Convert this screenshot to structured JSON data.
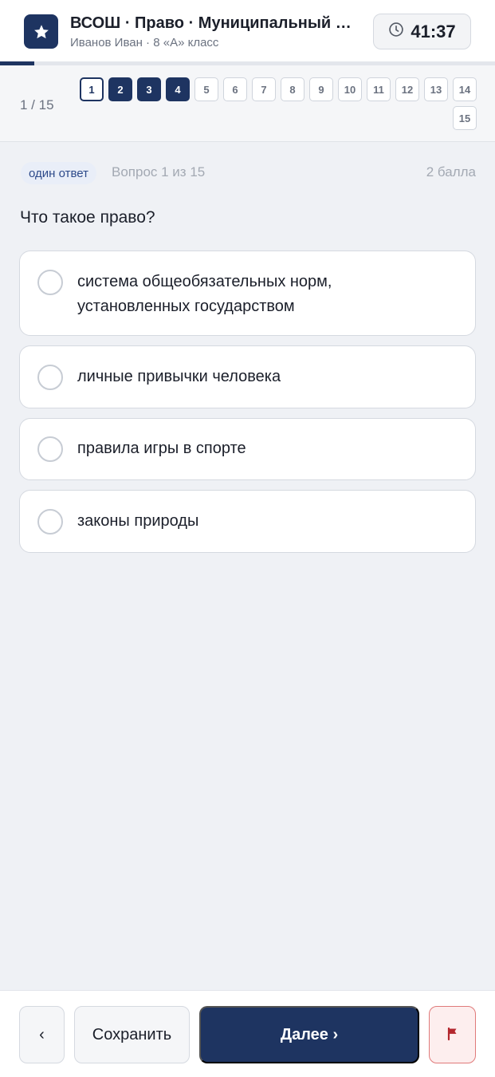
{
  "header": {
    "title": "ВСОШ · Право · Муниципальный этап",
    "subtitle": "Иванов Иван · 8 «А» класс",
    "timer": "41:37",
    "logo_icon": "star-icon",
    "timer_icon": "clock-icon"
  },
  "progress": {
    "fraction": 0.07
  },
  "question_nav": {
    "counter": "1 / 15",
    "buttons": [
      {
        "label": "1",
        "state": "current"
      },
      {
        "label": "2",
        "state": "answered"
      },
      {
        "label": "3",
        "state": "answered"
      },
      {
        "label": "4",
        "state": "answered"
      },
      {
        "label": "5",
        "state": "empty"
      },
      {
        "label": "6",
        "state": "empty"
      },
      {
        "label": "7",
        "state": "empty"
      },
      {
        "label": "8",
        "state": "empty"
      },
      {
        "label": "9",
        "state": "empty"
      },
      {
        "label": "10",
        "state": "empty"
      },
      {
        "label": "11",
        "state": "empty"
      },
      {
        "label": "12",
        "state": "empty"
      },
      {
        "label": "13",
        "state": "empty"
      },
      {
        "label": "14",
        "state": "empty"
      },
      {
        "label": "15",
        "state": "empty"
      }
    ]
  },
  "question": {
    "type_badge": "один ответ",
    "number_text": "Вопрос 1 из 15",
    "points": "2 балла",
    "text": "Что такое право?",
    "options": [
      {
        "line1": "система общеобязательных норм,",
        "line2": "установленных государством"
      },
      {
        "line1": "личные привычки человека"
      },
      {
        "line1": "правила игры в спорте"
      },
      {
        "line1": "законы природы"
      }
    ]
  },
  "footer": {
    "prev_label": "‹",
    "save_label": "Сохранить",
    "next_label": "Далее ›",
    "flag_icon": "flag-icon"
  },
  "colors": {
    "accent": "#1e3461",
    "flag": "#b3262d",
    "background": "#eff1f5"
  }
}
